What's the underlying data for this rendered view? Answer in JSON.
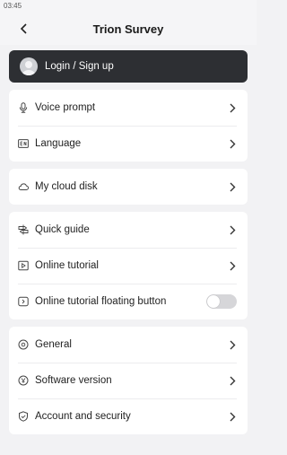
{
  "status_bar": {
    "time": "03:45"
  },
  "header": {
    "title": "Trion Survey",
    "back_icon": "chevron-left-icon"
  },
  "login": {
    "label": "Login / Sign up",
    "icon": "avatar-icon"
  },
  "groups": [
    {
      "items": [
        {
          "label": "Voice prompt",
          "icon": "microphone-icon"
        },
        {
          "label": "Language",
          "icon": "language-icon"
        }
      ]
    },
    {
      "items": [
        {
          "label": "My cloud disk",
          "icon": "cloud-icon"
        }
      ]
    },
    {
      "items": [
        {
          "label": "Quick guide",
          "icon": "guide-icon"
        },
        {
          "label": "Online tutorial",
          "icon": "play-icon"
        },
        {
          "label": "Online tutorial floating button",
          "icon": "floating-button-icon",
          "toggle": false
        }
      ]
    },
    {
      "items": [
        {
          "label": "General",
          "icon": "general-icon"
        },
        {
          "label": "Software version",
          "icon": "version-icon"
        },
        {
          "label": "Account and security",
          "icon": "shield-icon"
        }
      ]
    }
  ],
  "colors": {
    "login_bg": "#2d2f33",
    "page_bg": "#f2f2f4",
    "card_bg": "#ffffff",
    "toggle_off": "#d6d6d9"
  }
}
